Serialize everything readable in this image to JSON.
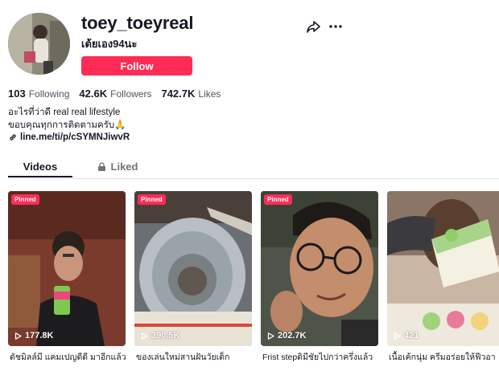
{
  "profile": {
    "username": "toey_toeyreal",
    "nickname": "เต้ยเอง94นะ",
    "follow_label": "Follow"
  },
  "stats": [
    {
      "value": "103",
      "label": "Following"
    },
    {
      "value": "42.6K",
      "label": "Followers"
    },
    {
      "value": "742.7K",
      "label": "Likes"
    }
  ],
  "bio": {
    "line1": "อะไรที่ว่าดี real real lifestyle",
    "line2": "ขอบคุณทุกการติดตามครับ🙏",
    "link": "line.me/ti/p/cSYMNJiwvR"
  },
  "tabs": {
    "videos": "Videos",
    "liked": "Liked"
  },
  "videos": [
    {
      "pinned": "Pinned",
      "views": "177.8K",
      "caption": "ดัชมิลล์มี แคมเปญดีดี มาอีกแล้ว"
    },
    {
      "pinned": "Pinned",
      "views": "390.5K",
      "caption": "ของเล่นใหม่สานฝันวัยเด็ก"
    },
    {
      "pinned": "Pinned",
      "views": "202.7K",
      "caption": "Frist stepดิมีชัยไปกว่าครึ่งแล้ว"
    },
    {
      "views": "421",
      "caption": "เนื้อเค้กนุ่ม ครีมอร่อยให้ฟีวอา"
    }
  ],
  "colors": {
    "accent": "#fe2c55",
    "text": "#161823",
    "secondary": "#535461"
  }
}
